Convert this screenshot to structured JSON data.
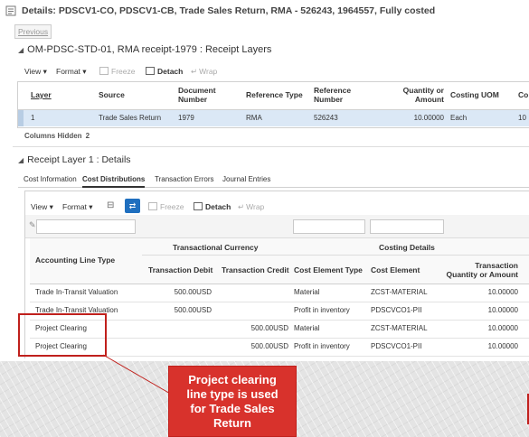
{
  "header": {
    "title": "Details: PDSCV1-CO, PDSCV1-CB, Trade Sales Return, RMA - 526243, 1964557, Fully costed",
    "previous": "Previous"
  },
  "receipt_layers": {
    "section_title": "OM-PDSC-STD-01, RMA receipt-1979 : Receipt Layers",
    "toolbar": {
      "view": "View",
      "format": "Format",
      "freeze": "Freeze",
      "detach": "Detach",
      "wrap": "Wrap"
    },
    "columns": [
      "Layer",
      "Source",
      "Document Number",
      "Reference Type",
      "Reference Number",
      "Quantity or Amount",
      "Costing UOM",
      "Co"
    ],
    "rows": [
      {
        "layer": "1",
        "source": "Trade Sales Return",
        "document": "1979",
        "ref_type": "RMA",
        "ref_number": "526243",
        "quantity": "10.00000",
        "uom": "Each",
        "co": "10"
      }
    ],
    "columns_hidden_label": "Columns Hidden",
    "columns_hidden_count": "2"
  },
  "details": {
    "section_title": "Receipt Layer 1 : Details",
    "tabs": [
      "Cost Information",
      "Cost Distributions",
      "Transaction Errors",
      "Journal Entries"
    ],
    "active_tab": 1,
    "toolbar": {
      "view": "View",
      "format": "Format",
      "freeze": "Freeze",
      "detach": "Detach",
      "wrap": "Wrap"
    },
    "group_headers": {
      "transactional": "Transactional Currency",
      "costing": "Costing Details"
    },
    "columns": [
      "Accounting Line Type",
      "Transaction Debit",
      "Transaction Credit",
      "Cost Element Type",
      "Cost Element",
      "Transaction Quantity or Amount"
    ],
    "rows": [
      {
        "line_type": "Trade In-Transit Valuation",
        "debit": "500.00USD",
        "credit": "",
        "element_type": "Material",
        "element": "ZCST-MATERIAL",
        "quantity": "10.00000"
      },
      {
        "line_type": "Trade In-Transit Valuation",
        "debit": "500.00USD",
        "credit": "",
        "element_type": "Profit in inventory",
        "element": "PDSCVCO1-PII",
        "quantity": "10.00000"
      },
      {
        "line_type": "Project Clearing",
        "debit": "",
        "credit": "500.00USD",
        "element_type": "Material",
        "element": "ZCST-MATERIAL",
        "quantity": "10.00000"
      },
      {
        "line_type": "Project Clearing",
        "debit": "",
        "credit": "500.00USD",
        "element_type": "Profit in inventory",
        "element": "PDSCVCO1-PII",
        "quantity": "10.00000"
      }
    ]
  },
  "callout": {
    "text": "Project clearing line type is used for Trade Sales Return",
    "color": "#d8322c",
    "border_color": "#c0201c"
  },
  "colors": {
    "selected_row": "#dbe8f6",
    "accent": "#1f6fbf"
  }
}
